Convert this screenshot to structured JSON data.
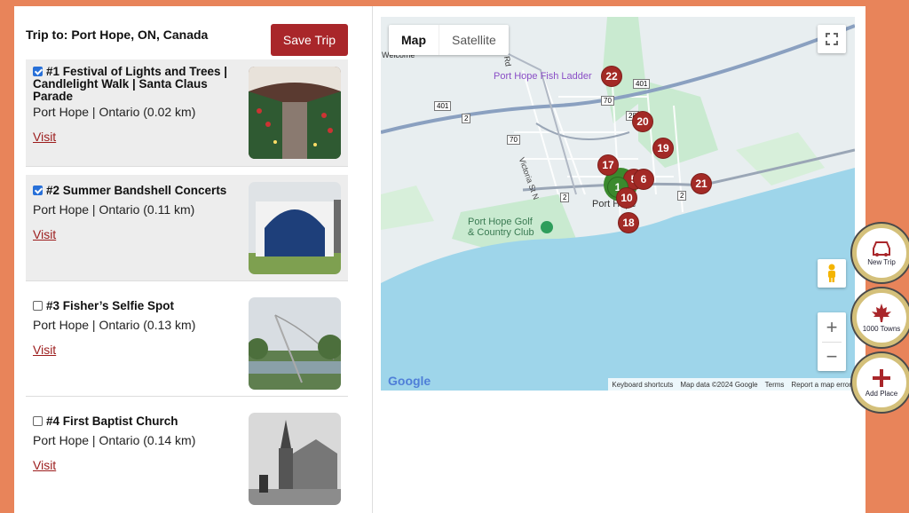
{
  "trip": {
    "title": "Trip to: Port Hope, ON, Canada",
    "save_label": "Save Trip"
  },
  "places": [
    {
      "name": "#1 Festival of Lights and Trees | Candlelight Walk | Santa Claus Parade",
      "location": "Port Hope | Ontario (0.02 km)",
      "visit": "Visit",
      "checked": true
    },
    {
      "name": "#2 Summer Bandshell Concerts",
      "location": "Port Hope | Ontario (0.11 km)",
      "visit": "Visit",
      "checked": true
    },
    {
      "name": "#3 Fisher’s Selfie Spot",
      "location": "Port Hope | Ontario (0.13 km)",
      "visit": "Visit",
      "checked": false
    },
    {
      "name": "#4 First Baptist Church",
      "location": "Port Hope | Ontario (0.14 km)",
      "visit": "Visit",
      "checked": false
    }
  ],
  "map": {
    "tab_map": "Map",
    "tab_satellite": "Satellite",
    "labels": {
      "fish_ladder": "Port Hope Fish Ladder",
      "golf": "Port Hope Golf & Country Club",
      "town": "Port Hope",
      "victoria": "Victoria St N",
      "welcome": "Welcome",
      "rd": "Rd"
    },
    "route_shields": [
      "401",
      "401",
      "2",
      "2",
      "2",
      "70",
      "70",
      "28"
    ],
    "markers": [
      "22",
      "20",
      "19",
      "17",
      "5",
      "6",
      "1",
      "10",
      "21",
      "18"
    ],
    "zoom_in": "+",
    "zoom_out": "−",
    "google": "Google",
    "footer": [
      "Keyboard shortcuts",
      "Map data ©2024 Google",
      "Terms",
      "Report a map error"
    ]
  },
  "fabs": [
    {
      "label": "New Trip",
      "icon": "car-icon"
    },
    {
      "label": "1000 Towns",
      "icon": "maple-leaf-icon"
    },
    {
      "label": "Add Place",
      "icon": "plus-icon"
    }
  ],
  "colors": {
    "accent": "#a9262a",
    "background": "#e8845a",
    "water": "#9ed5ea",
    "land": "#e8eef0",
    "park": "#c9ead0"
  }
}
